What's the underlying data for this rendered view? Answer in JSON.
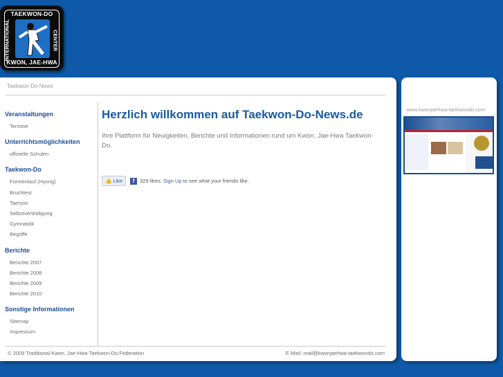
{
  "logo": {
    "top_text": "TAEKWON-DO",
    "bottom_text": "KWON, JAE-HWA",
    "left_text": "INTERNATIONAL",
    "right_text": "CENTER"
  },
  "breadcrumb": "Taekwon-Do News",
  "sidebar": {
    "sections": [
      {
        "title": "Veranstaltungen",
        "items": [
          "Termine"
        ]
      },
      {
        "title": "Unterrichtsmöglichkeiten",
        "items": [
          "offizielle Schulen"
        ]
      },
      {
        "title": "Taekwon-Do",
        "items": [
          "Formenlauf (Hyong)",
          "Bruchtest",
          "Taeryon",
          "Selbstverteidigung",
          "Gymnastik",
          "Begriffe"
        ]
      },
      {
        "title": "Berichte",
        "items": [
          "Berichte 2007",
          "Berichte 2008",
          "Berichte 2009",
          "Berichte 2010"
        ]
      },
      {
        "title": "Sonstige Informationen",
        "items": [
          "Sitemap",
          "Impressum"
        ]
      }
    ]
  },
  "content": {
    "heading": "Herzlich willkommen auf Taekwon-Do-News.de",
    "intro": "Ihre Plattform für Neuigkeiten, Berichte und Informationen rund um Kwon, Jae-Hwa Taekwon-Do."
  },
  "facebook": {
    "like_label": "Like",
    "likes_text": "329 likes.",
    "signup_label": "Sign Up",
    "tail_text": "to see what your friends like."
  },
  "footer": {
    "copyright": "© 2009 Traditional Kwon, Jae-Hwa Taekwon-Do Federation",
    "email": "E-Mail: mail@kwonjaehwa-taekwondo.com"
  },
  "right_panel": {
    "url": "www.kwonjaehwa-taekwondo.com"
  },
  "colors": {
    "background": "#0f5aa8",
    "heading": "#1a5aa0",
    "section_title": "#1a4f96",
    "facebook": "#3b5998"
  }
}
